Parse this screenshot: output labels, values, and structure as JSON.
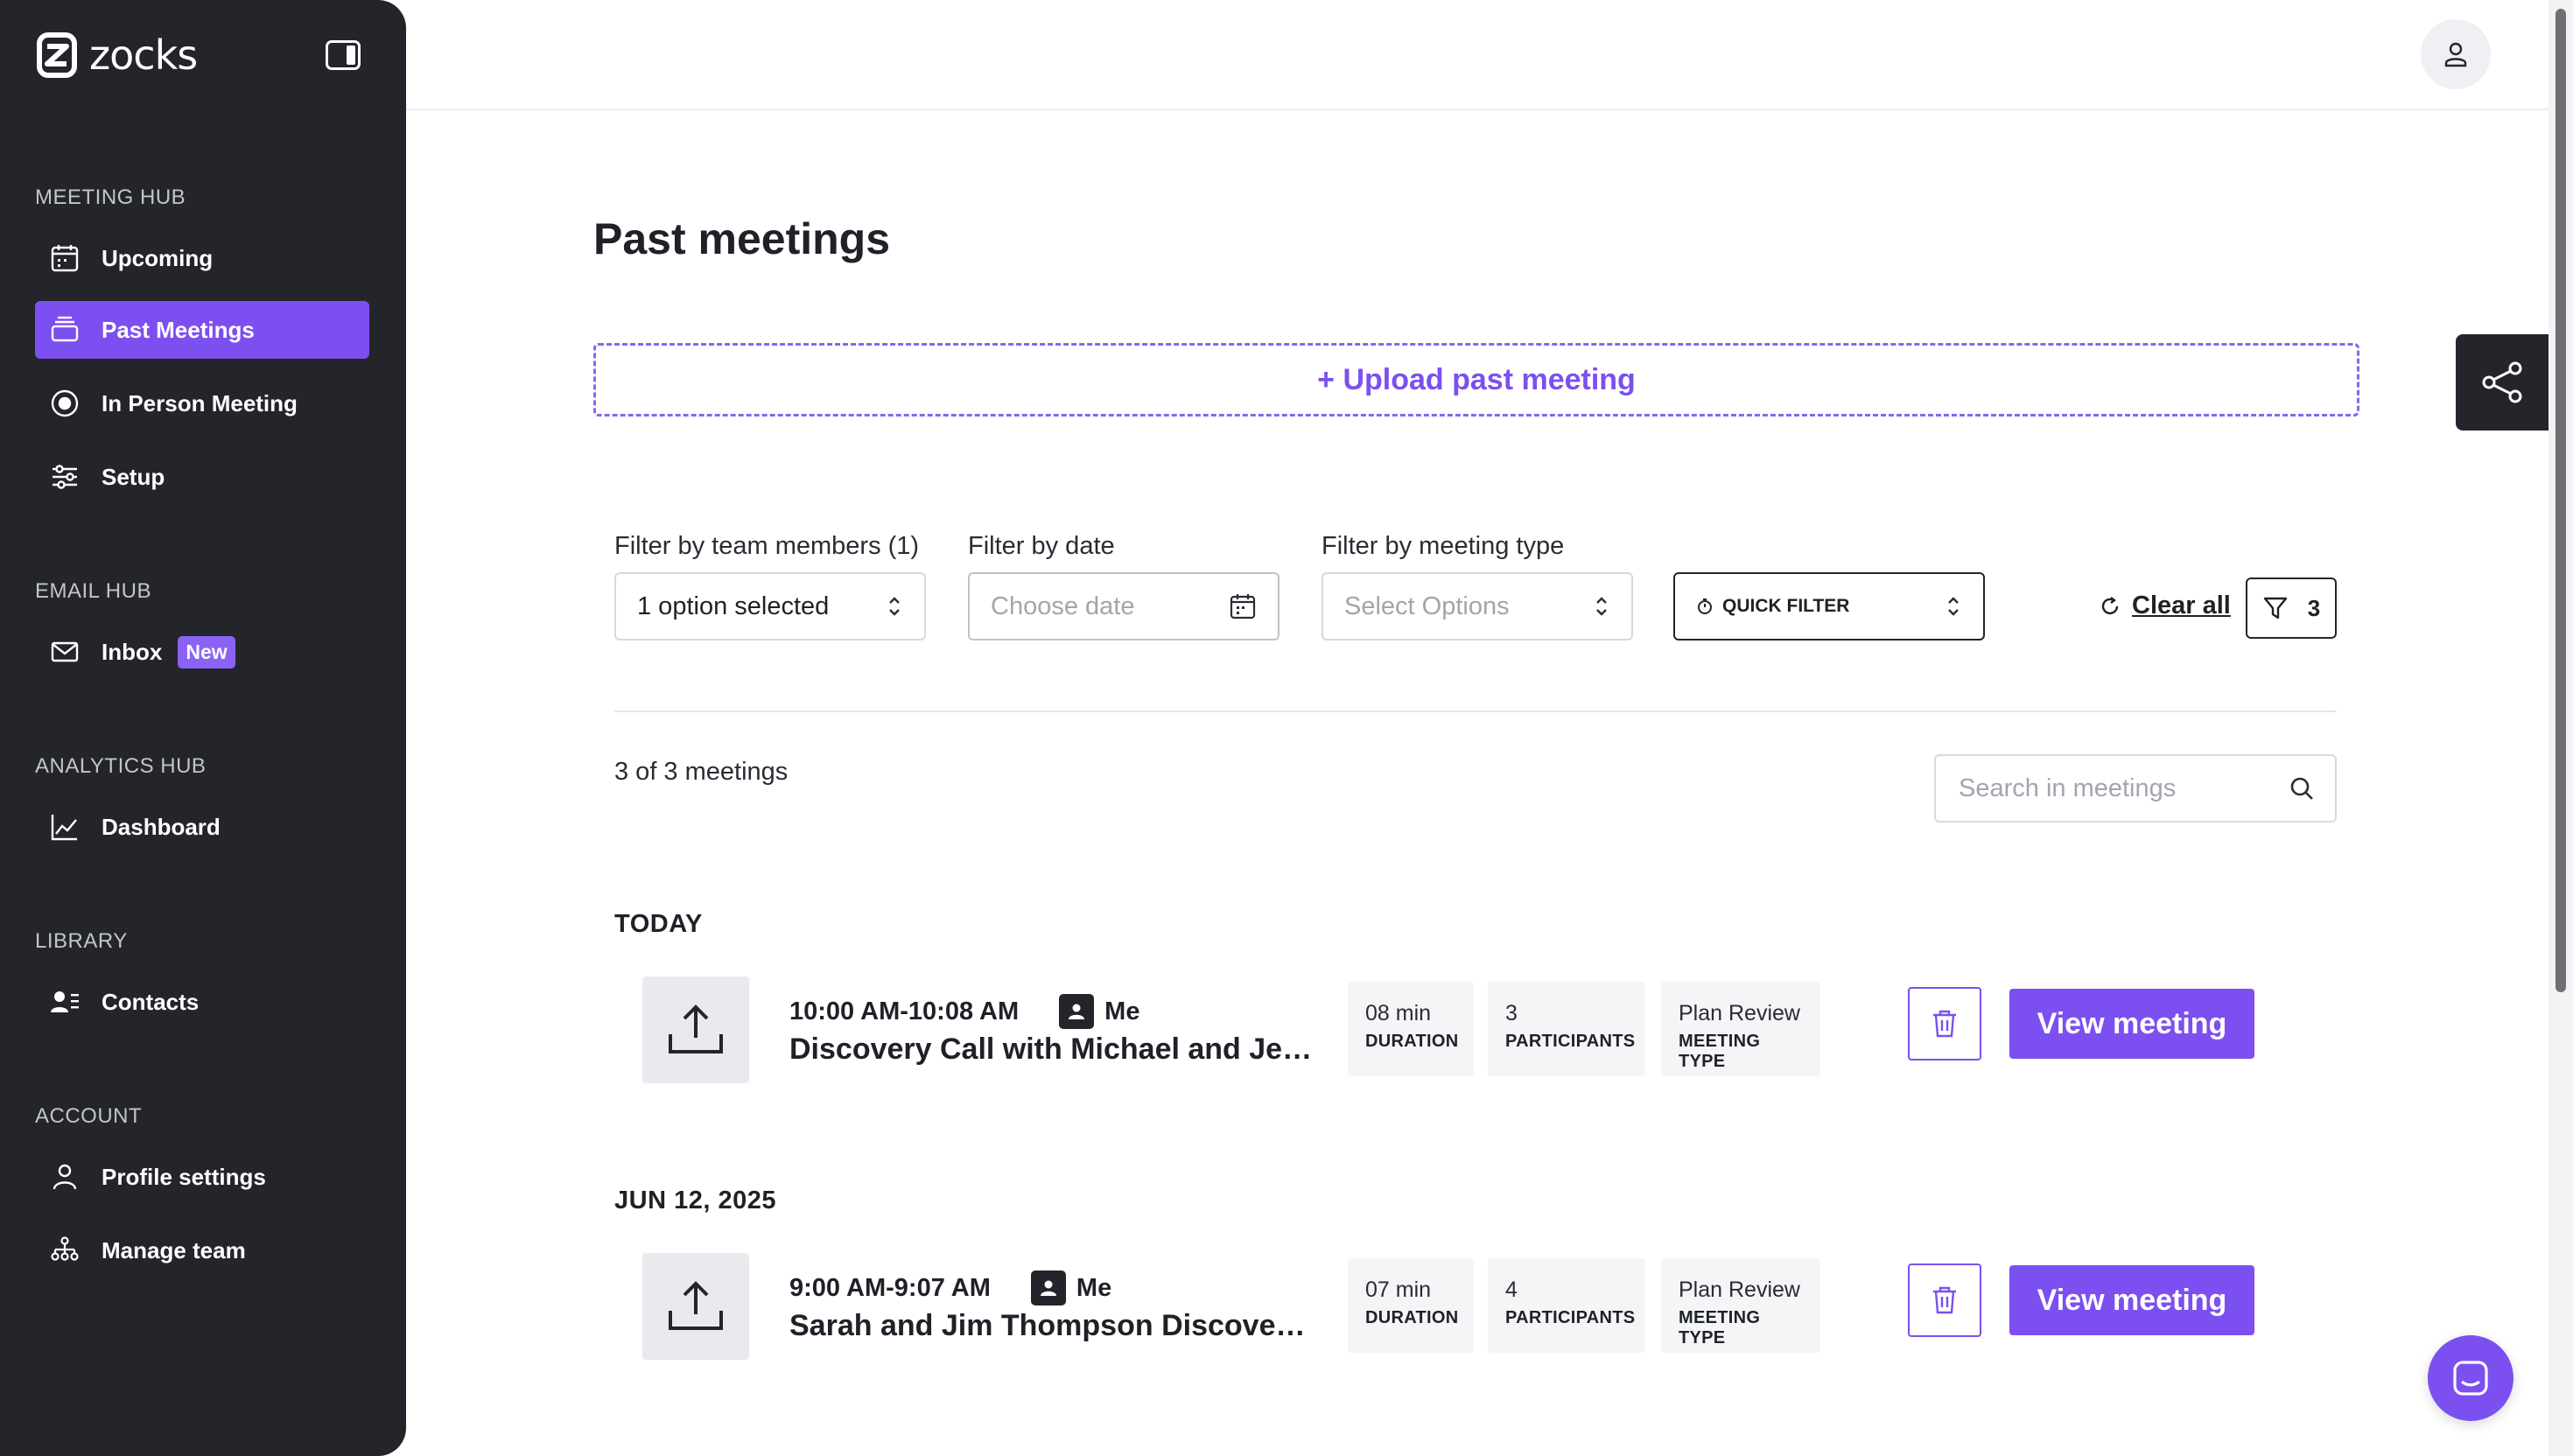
{
  "brand": {
    "name": "zocks"
  },
  "sidebar": {
    "sections": [
      {
        "title": "MEETING HUB",
        "items": [
          {
            "label": "Upcoming",
            "icon": "calendar-icon"
          },
          {
            "label": "Past Meetings",
            "icon": "stack-icon",
            "active": true
          },
          {
            "label": "In Person Meeting",
            "icon": "record-icon"
          },
          {
            "label": "Setup",
            "icon": "sliders-icon"
          }
        ]
      },
      {
        "title": "EMAIL HUB",
        "items": [
          {
            "label": "Inbox",
            "icon": "mail-icon",
            "badge": "New"
          }
        ]
      },
      {
        "title": "ANALYTICS HUB",
        "items": [
          {
            "label": "Dashboard",
            "icon": "chart-line-icon"
          }
        ]
      },
      {
        "title": "LIBRARY",
        "items": [
          {
            "label": "Contacts",
            "icon": "contacts-icon"
          }
        ]
      },
      {
        "title": "ACCOUNT",
        "items": [
          {
            "label": "Profile settings",
            "icon": "user-icon"
          },
          {
            "label": "Manage team",
            "icon": "team-icon"
          }
        ]
      }
    ]
  },
  "main": {
    "title": "Past meetings",
    "upload_label": "+ Upload past meeting",
    "filters": {
      "team": {
        "label": "Filter by team members (1)",
        "value": "1 option selected"
      },
      "date": {
        "label": "Filter by date",
        "placeholder": "Choose date"
      },
      "type": {
        "label": "Filter by meeting type",
        "placeholder": "Select Options"
      },
      "quick": {
        "value": "QUICK FILTER"
      },
      "clear_label": "Clear all",
      "active_count": "3"
    },
    "count_text": "3 of 3 meetings",
    "search_placeholder": "Search in meetings",
    "groups": [
      {
        "date": "TODAY",
        "meetings": [
          {
            "time": "10:00 AM-10:08 AM",
            "owner": "Me",
            "title": "Discovery Call with Michael and Jennifer",
            "duration": "08 min",
            "duration_label": "DURATION",
            "participants": "3",
            "participants_label": "PARTICIPANTS",
            "meeting_type": "Plan Review",
            "meeting_type_label": "MEETING TYPE",
            "view_label": "View meeting"
          }
        ]
      },
      {
        "date": "JUN 12, 2025",
        "meetings": [
          {
            "time": "9:00 AM-9:07 AM",
            "owner": "Me",
            "title": "Sarah and Jim Thompson Discovery Call",
            "duration": "07 min",
            "duration_label": "DURATION",
            "participants": "4",
            "participants_label": "PARTICIPANTS",
            "meeting_type": "Plan Review",
            "meeting_type_label": "MEETING TYPE",
            "view_label": "View meeting"
          }
        ]
      }
    ]
  },
  "colors": {
    "accent": "#7c4ff0",
    "sidebar_bg": "#23252b"
  }
}
